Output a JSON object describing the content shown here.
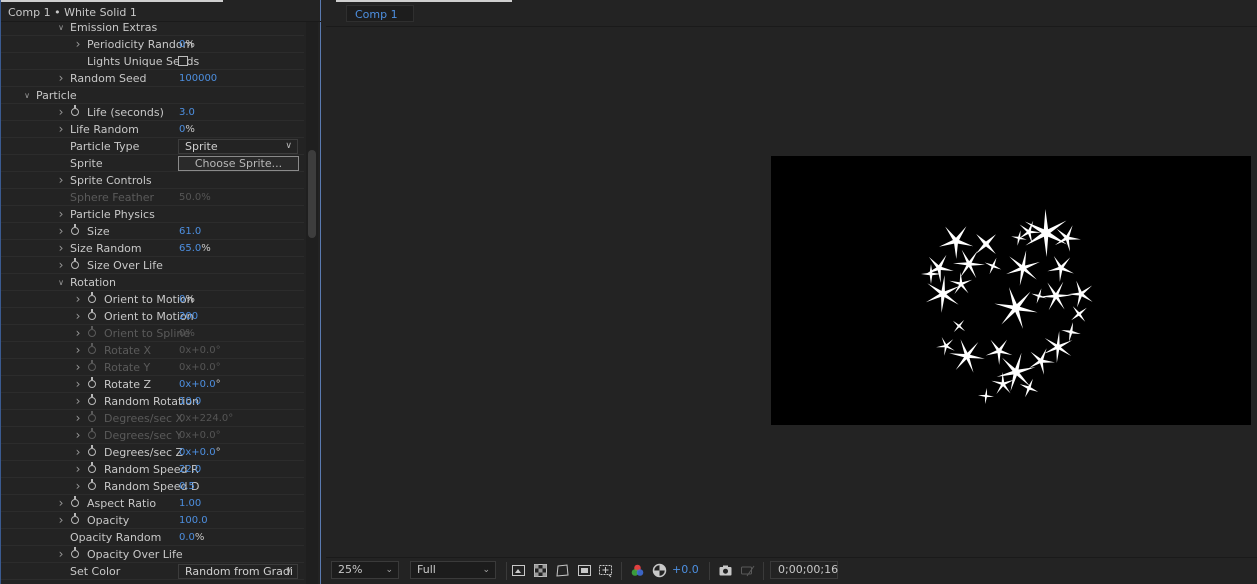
{
  "effect_controls": {
    "title": "Comp 1 • White Solid 1",
    "rows": [
      {
        "indent": 1,
        "twirl": "open",
        "stopwatch": false,
        "label": "Emission Extras",
        "value": "",
        "unit": "",
        "disabled": false
      },
      {
        "indent": 2,
        "twirl": "closed",
        "stopwatch": false,
        "label": "Periodicity Random",
        "value": "0",
        "unit": "%",
        "disabled": false
      },
      {
        "indent": 2,
        "twirl": "none",
        "stopwatch": false,
        "label": "Lights Unique Seeds",
        "value": "",
        "unit": "",
        "disabled": false,
        "control": "checkbox"
      },
      {
        "indent": 1,
        "twirl": "closed",
        "stopwatch": false,
        "label": "Random Seed",
        "value": "100000",
        "unit": "",
        "disabled": false
      },
      {
        "indent": 0,
        "twirl": "open",
        "stopwatch": false,
        "label": "Particle",
        "value": "",
        "unit": "",
        "disabled": false
      },
      {
        "indent": 1,
        "twirl": "closed",
        "stopwatch": true,
        "label": "Life (seconds)",
        "value": "3.0",
        "unit": "",
        "disabled": false
      },
      {
        "indent": 1,
        "twirl": "closed",
        "stopwatch": false,
        "label": "Life Random",
        "value": "0",
        "unit": "%",
        "disabled": false
      },
      {
        "indent": 1,
        "twirl": "none",
        "stopwatch": false,
        "label": "Particle Type",
        "value": "Sprite",
        "unit": "",
        "disabled": false,
        "control": "dropdown"
      },
      {
        "indent": 1,
        "twirl": "none",
        "stopwatch": false,
        "label": "Sprite",
        "value": "Choose Sprite...",
        "unit": "",
        "disabled": false,
        "control": "button"
      },
      {
        "indent": 1,
        "twirl": "closed",
        "stopwatch": false,
        "label": "Sprite Controls",
        "value": "",
        "unit": "",
        "disabled": false
      },
      {
        "indent": 1,
        "twirl": "none",
        "stopwatch": false,
        "label": "Sphere Feather",
        "value": "50.0",
        "unit": "%",
        "disabled": true
      },
      {
        "indent": 1,
        "twirl": "closed",
        "stopwatch": false,
        "label": "Particle Physics",
        "value": "",
        "unit": "",
        "disabled": false
      },
      {
        "indent": 1,
        "twirl": "closed",
        "stopwatch": true,
        "label": "Size",
        "value": "61.0",
        "unit": "",
        "disabled": false
      },
      {
        "indent": 1,
        "twirl": "closed",
        "stopwatch": false,
        "label": "Size Random",
        "value": "65.0",
        "unit": "%",
        "disabled": false
      },
      {
        "indent": 1,
        "twirl": "closed",
        "stopwatch": true,
        "label": "Size Over Life",
        "value": "",
        "unit": "",
        "disabled": false
      },
      {
        "indent": 1,
        "twirl": "open",
        "stopwatch": false,
        "label": "Rotation",
        "value": "",
        "unit": "",
        "disabled": false
      },
      {
        "indent": 2,
        "twirl": "closed",
        "stopwatch": true,
        "label": "Orient to Motion",
        "value": "0",
        "unit": "%",
        "disabled": false
      },
      {
        "indent": 2,
        "twirl": "closed",
        "stopwatch": true,
        "label": "Orient to Motion",
        "value": "200",
        "unit": "",
        "disabled": false
      },
      {
        "indent": 2,
        "twirl": "closed",
        "stopwatch": true,
        "label": "Orient to Spline",
        "value": "0",
        "unit": "%",
        "disabled": true
      },
      {
        "indent": 2,
        "twirl": "closed",
        "stopwatch": true,
        "label": "Rotate X",
        "value": "0x+0.0",
        "unit": "°",
        "disabled": true
      },
      {
        "indent": 2,
        "twirl": "closed",
        "stopwatch": true,
        "label": "Rotate Y",
        "value": "0x+0.0",
        "unit": "°",
        "disabled": true
      },
      {
        "indent": 2,
        "twirl": "closed",
        "stopwatch": true,
        "label": "Rotate Z",
        "value": "0x+0.0",
        "unit": "°",
        "disabled": false
      },
      {
        "indent": 2,
        "twirl": "closed",
        "stopwatch": true,
        "label": "Random Rotation",
        "value": "10.0",
        "unit": "",
        "disabled": false
      },
      {
        "indent": 2,
        "twirl": "closed",
        "stopwatch": true,
        "label": "Degrees/sec X",
        "value": "0x+224.0",
        "unit": "°",
        "disabled": true
      },
      {
        "indent": 2,
        "twirl": "closed",
        "stopwatch": true,
        "label": "Degrees/sec Y",
        "value": "0x+0.0",
        "unit": "°",
        "disabled": true
      },
      {
        "indent": 2,
        "twirl": "closed",
        "stopwatch": true,
        "label": "Degrees/sec Z",
        "value": "0x+0.0",
        "unit": "°",
        "disabled": false
      },
      {
        "indent": 2,
        "twirl": "closed",
        "stopwatch": true,
        "label": "Random Speed R",
        "value": "22.0",
        "unit": "",
        "disabled": false
      },
      {
        "indent": 2,
        "twirl": "closed",
        "stopwatch": true,
        "label": "Random Speed D",
        "value": "0.5",
        "unit": "",
        "disabled": false
      },
      {
        "indent": 1,
        "twirl": "closed",
        "stopwatch": true,
        "label": "Aspect Ratio",
        "value": "1.00",
        "unit": "",
        "disabled": false
      },
      {
        "indent": 1,
        "twirl": "closed",
        "stopwatch": true,
        "label": "Opacity",
        "value": "100.0",
        "unit": "",
        "disabled": false
      },
      {
        "indent": 1,
        "twirl": "none",
        "stopwatch": false,
        "label": "Opacity Random",
        "value": "0.0",
        "unit": "%",
        "disabled": false
      },
      {
        "indent": 1,
        "twirl": "closed",
        "stopwatch": true,
        "label": "Opacity Over Life",
        "value": "",
        "unit": "",
        "disabled": false
      },
      {
        "indent": 1,
        "twirl": "none",
        "stopwatch": false,
        "label": "Set Color",
        "value": "Random from Gradi",
        "unit": "",
        "disabled": false,
        "control": "dropdown"
      }
    ]
  },
  "composition": {
    "tab_label": "Comp 1"
  },
  "toolbar": {
    "zoom": "25%",
    "resolution": "Full",
    "exposure": "+0.0",
    "timecode": "0;00;00;16"
  },
  "colors": {
    "accent": "#4d8fe0",
    "panel_bg": "#232323",
    "canvas_bg": "#000000"
  },
  "icons": [
    "chevron-right-icon",
    "chevron-down-icon",
    "stopwatch-icon",
    "region-of-interest-icon",
    "transparency-grid-icon",
    "mask-path-icon",
    "guides-icon",
    "channel-icon",
    "exposure-reset-icon",
    "snapshot-icon",
    "show-snapshot-icon"
  ]
}
